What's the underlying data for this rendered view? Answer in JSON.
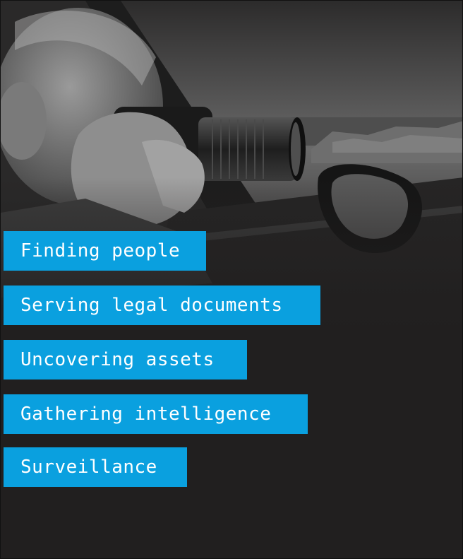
{
  "hero": {
    "image_icon": "photographer-in-car-image"
  },
  "services": {
    "items": [
      {
        "label": "Finding people"
      },
      {
        "label": "Serving legal documents"
      },
      {
        "label": "Uncovering assets"
      },
      {
        "label": "Gathering intelligence"
      },
      {
        "label": "Surveillance"
      }
    ]
  },
  "colors": {
    "accent": "#0aa0df",
    "panel": "#211f1f",
    "text": "#ffffff"
  }
}
